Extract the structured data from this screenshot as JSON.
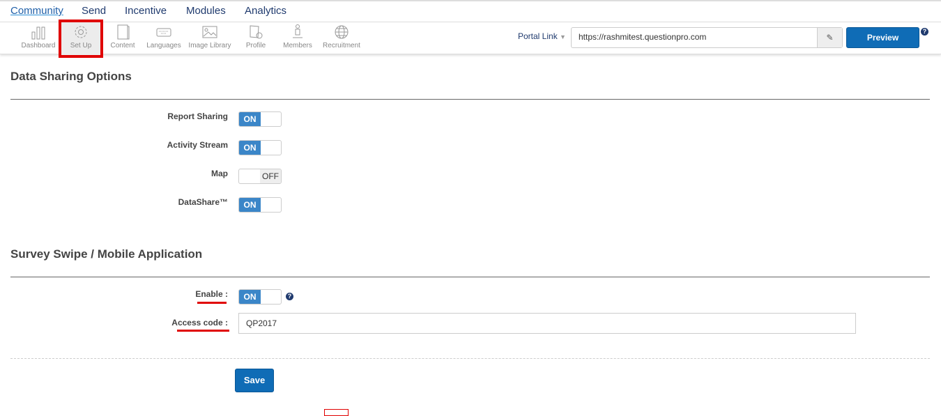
{
  "top_nav": {
    "tabs": [
      {
        "label": "Community",
        "active": true
      },
      {
        "label": "Send"
      },
      {
        "label": "Incentive"
      },
      {
        "label": "Modules"
      },
      {
        "label": "Analytics"
      }
    ]
  },
  "toolbar": {
    "items": [
      {
        "label": "Dashboard",
        "icon": "bar-chart-icon"
      },
      {
        "label": "Set Up",
        "icon": "gear-icon",
        "selected": true
      },
      {
        "label": "Content",
        "icon": "document-icon"
      },
      {
        "label": "Languages",
        "icon": "keyboard-icon"
      },
      {
        "label": "Image Library",
        "icon": "image-icon"
      },
      {
        "label": "Profile",
        "icon": "profile-icon"
      },
      {
        "label": "Members",
        "icon": "person-icon"
      },
      {
        "label": "Recruitment",
        "icon": "globe-icon"
      }
    ],
    "portal_link_label": "Portal Link",
    "portal_url": "https://rashmitest.questionpro.com",
    "preview_label": "Preview",
    "help": "?"
  },
  "data_sharing": {
    "title": "Data Sharing Options",
    "options": [
      {
        "label": "Report Sharing",
        "state": "ON"
      },
      {
        "label": "Activity Stream",
        "state": "ON"
      },
      {
        "label": "Map",
        "state": "OFF"
      },
      {
        "label": "DataShare™",
        "state": "ON"
      }
    ]
  },
  "survey_swipe": {
    "title": "Survey Swipe / Mobile Application",
    "enable_label": "Enable :",
    "enable_state": "ON",
    "help": "?",
    "access_code_label": "Access code :",
    "access_code_value": "QP2017"
  },
  "save_label": "Save",
  "colors": {
    "accent": "#0f6cb6",
    "toggle_on": "#3b86c8",
    "highlight": "#e00000"
  }
}
